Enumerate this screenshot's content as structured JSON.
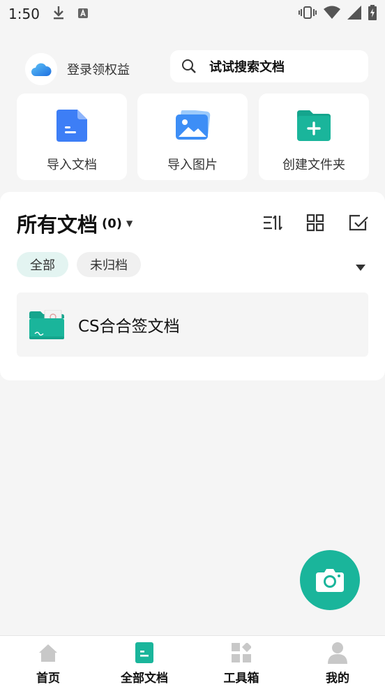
{
  "status_bar": {
    "time": "1:50"
  },
  "header": {
    "login_label": "登录领权益",
    "search_placeholder": "试试搜索文档"
  },
  "actions": [
    {
      "label": "导入文档",
      "icon": "doc-icon"
    },
    {
      "label": "导入图片",
      "icon": "image-icon"
    },
    {
      "label": "创建文件夹",
      "icon": "folder-add-icon"
    }
  ],
  "docs": {
    "title": "所有文档",
    "count": "(0)",
    "filters": [
      "全部",
      "未归档"
    ],
    "active_filter": "全部",
    "items": [
      {
        "name": "CS合合签文档"
      }
    ]
  },
  "bottom_nav": [
    {
      "label": "首页",
      "icon": "home-icon"
    },
    {
      "label": "全部文档",
      "icon": "docs-icon",
      "active": true
    },
    {
      "label": "工具箱",
      "icon": "toolbox-icon"
    },
    {
      "label": "我的",
      "icon": "profile-icon"
    }
  ],
  "colors": {
    "accent": "#1ab59b",
    "blue": "#3d7ef6"
  }
}
